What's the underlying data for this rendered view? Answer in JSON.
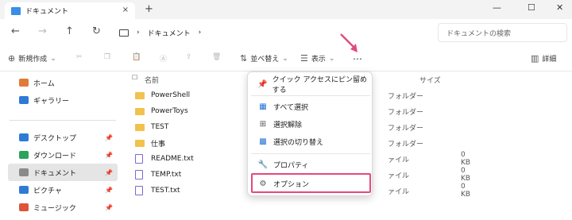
{
  "tab": {
    "title": "ドキュメント",
    "close": "×",
    "new_tab": "+"
  },
  "window": {
    "minimize": "—",
    "maximize": "☐",
    "close": "✕"
  },
  "nav": {
    "back": "←",
    "forward": "→",
    "up": "↑",
    "refresh": "↻",
    "breadcrumb": [
      "›",
      "ドキュメント",
      "›"
    ]
  },
  "search": {
    "placeholder": "ドキュメントの検索"
  },
  "cmdbar": {
    "new": "新規作成",
    "sort": "並べ替え",
    "view": "表示",
    "more": "…",
    "details": "詳細"
  },
  "sidebar": {
    "items": [
      {
        "label": "ホーム",
        "color": "#e07b39"
      },
      {
        "label": "ギャラリー",
        "color": "#2e7bd6"
      },
      {
        "label": "デスクトップ",
        "color": "#2e7bd6"
      },
      {
        "label": "ダウンロード",
        "color": "#2ba35a"
      },
      {
        "label": "ドキュメント",
        "color": "#8a8a8a"
      },
      {
        "label": "ピクチャ",
        "color": "#2e7bd6"
      },
      {
        "label": "ミュージック",
        "color": "#e0533a"
      }
    ]
  },
  "columns": {
    "name": "名前",
    "size": "サイズ"
  },
  "files": [
    {
      "name": "PowerShell",
      "type": "フォルダー",
      "size": ""
    },
    {
      "name": "PowerToys",
      "type": "フォルダー",
      "size": ""
    },
    {
      "name": "TEST",
      "type": "フォルダー",
      "size": ""
    },
    {
      "name": "仕事",
      "type": "フォルダー",
      "size": ""
    },
    {
      "name": "README.txt",
      "type": "ァイル",
      "size": "0 KB"
    },
    {
      "name": "TEMP.txt",
      "type": "ァイル",
      "size": "0 KB"
    },
    {
      "name": "TEST.txt",
      "type": "ァイル",
      "size": "0 KB"
    }
  ],
  "menu": {
    "items": [
      {
        "label": "クイック アクセスにピン留めする",
        "icon": "pin-icon"
      },
      {
        "label": "すべて選択",
        "icon": "select-all-icon"
      },
      {
        "label": "選択解除",
        "icon": "select-none-icon"
      },
      {
        "label": "選択の切り替え",
        "icon": "invert-selection-icon"
      },
      {
        "label": "プロパティ",
        "icon": "properties-icon"
      },
      {
        "label": "オプション",
        "icon": "options-icon"
      }
    ]
  },
  "colors": {
    "highlight": "#e24a7f",
    "accent": "#1e6fd9"
  }
}
